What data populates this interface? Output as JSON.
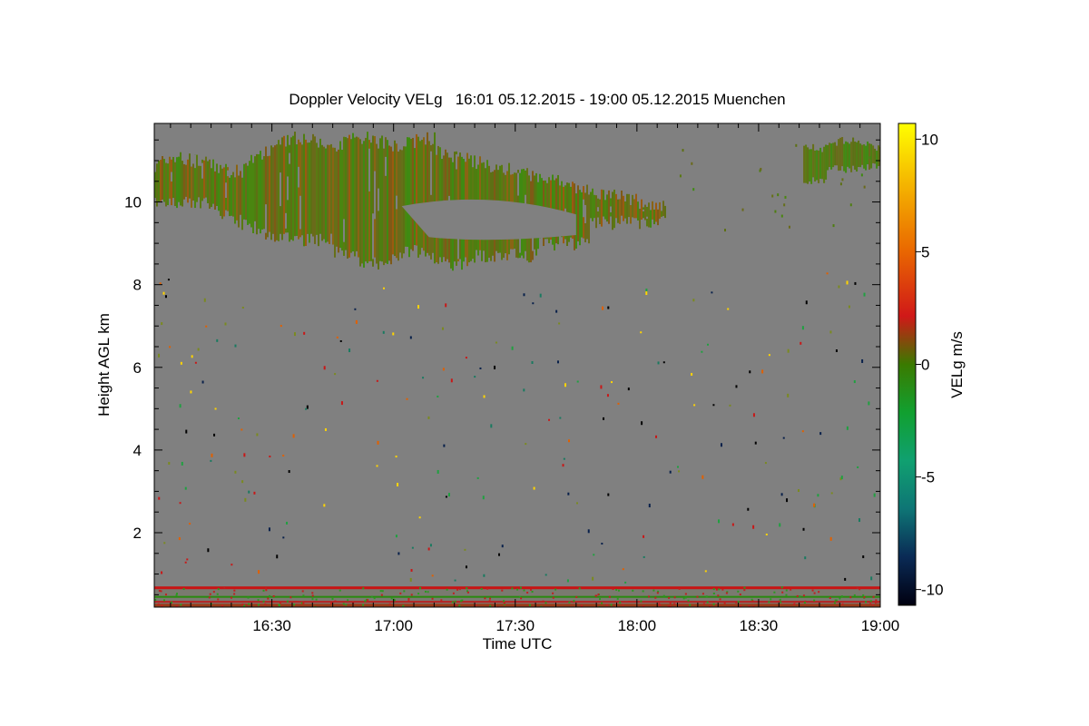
{
  "chart_data": {
    "type": "heatmap",
    "title": "Doppler Velocity VELg   16:01 05.12.2015 - 19:00 05.12.2015 Muenchen",
    "xlabel": "Time UTC",
    "ylabel": "Height AGL km",
    "x_range": [
      "16:01",
      "19:00"
    ],
    "y_range_km": [
      0.2,
      11.9
    ],
    "x_ticks": [
      "16:30",
      "17:00",
      "17:30",
      "18:00",
      "18:30",
      "19:00"
    ],
    "y_ticks": [
      "2",
      "4",
      "6",
      "8",
      "10"
    ],
    "colorbar": {
      "label": "VELg m/s",
      "range": [
        -10.7,
        10.7
      ],
      "ticks": [
        "10",
        "5",
        "0",
        "-5",
        "-10"
      ],
      "colors": [
        "#ffff00",
        "#f08000",
        "#d01010",
        "#2a8a00",
        "#10a060",
        "#106070",
        "#000018"
      ]
    },
    "background_color": "#808080",
    "features": [
      {
        "name": "cloud layer",
        "time_start": "16:01",
        "time_end": "18:07",
        "height_km": [
          8.5,
          11.6
        ],
        "velocity_ms": 0
      },
      {
        "name": "upper cloud",
        "time_start": "18:41",
        "time_end": "19:00",
        "height_km": [
          10.5,
          11.4
        ],
        "velocity_ms": 0
      },
      {
        "name": "near-surface layer",
        "time_start": "16:01",
        "time_end": "19:00",
        "height_km": [
          0.25,
          0.7
        ],
        "velocity_ms": 1
      }
    ]
  }
}
